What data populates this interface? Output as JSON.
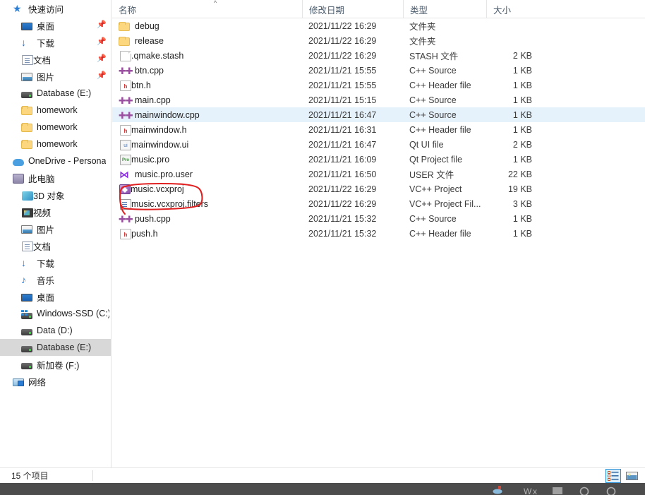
{
  "navpane": {
    "items": [
      {
        "label": "快速访问",
        "icon": "star-icon",
        "indent": 0,
        "pinned": false,
        "selected": false
      },
      {
        "label": "桌面",
        "icon": "desktop-icon",
        "indent": 1,
        "pinned": true,
        "selected": false
      },
      {
        "label": "下载",
        "icon": "downloads-icon",
        "indent": 1,
        "pinned": true,
        "selected": false
      },
      {
        "label": "文档",
        "icon": "documents-icon",
        "indent": 1,
        "pinned": true,
        "selected": false
      },
      {
        "label": "图片",
        "icon": "pictures-icon",
        "indent": 1,
        "pinned": true,
        "selected": false
      },
      {
        "label": "Database (E:)",
        "icon": "drive-icon",
        "indent": 1,
        "pinned": false,
        "selected": false
      },
      {
        "label": "homework",
        "icon": "folder-icon",
        "indent": 1,
        "pinned": false,
        "selected": false
      },
      {
        "label": "homework",
        "icon": "folder-icon",
        "indent": 1,
        "pinned": false,
        "selected": false
      },
      {
        "label": "homework",
        "icon": "folder-icon",
        "indent": 1,
        "pinned": false,
        "selected": false
      },
      {
        "label": "OneDrive - Persona",
        "icon": "onedrive-icon",
        "indent": 0,
        "pinned": false,
        "selected": false
      },
      {
        "label": "此电脑",
        "icon": "this-pc-icon",
        "indent": 0,
        "pinned": false,
        "selected": false
      },
      {
        "label": "3D 对象",
        "icon": "3d-objects-icon",
        "indent": 1,
        "pinned": false,
        "selected": false
      },
      {
        "label": "视频",
        "icon": "videos-icon",
        "indent": 1,
        "pinned": false,
        "selected": false
      },
      {
        "label": "图片",
        "icon": "pictures-icon",
        "indent": 1,
        "pinned": false,
        "selected": false
      },
      {
        "label": "文档",
        "icon": "documents-icon",
        "indent": 1,
        "pinned": false,
        "selected": false
      },
      {
        "label": "下载",
        "icon": "downloads-icon",
        "indent": 1,
        "pinned": false,
        "selected": false
      },
      {
        "label": "音乐",
        "icon": "music-icon",
        "indent": 1,
        "pinned": false,
        "selected": false
      },
      {
        "label": "桌面",
        "icon": "desktop-icon",
        "indent": 1,
        "pinned": false,
        "selected": false
      },
      {
        "label": "Windows-SSD (C:)",
        "icon": "windows-drive-icon",
        "indent": 1,
        "pinned": false,
        "selected": false
      },
      {
        "label": "Data (D:)",
        "icon": "drive-icon",
        "indent": 1,
        "pinned": false,
        "selected": false
      },
      {
        "label": "Database (E:)",
        "icon": "drive-icon",
        "indent": 1,
        "pinned": false,
        "selected": true
      },
      {
        "label": "新加卷 (F:)",
        "icon": "drive-icon",
        "indent": 1,
        "pinned": false,
        "selected": false
      },
      {
        "label": "网络",
        "icon": "network-icon",
        "indent": 0,
        "pinned": false,
        "selected": false
      }
    ]
  },
  "columns": {
    "name": "名称",
    "date_modified": "修改日期",
    "type": "类型",
    "size": "大小",
    "sort_indicator": "^",
    "sorted_by": "名称",
    "sort_direction": "ascending"
  },
  "files": [
    {
      "name": "debug",
      "date": "2021/11/22 16:29",
      "type": "文件夹",
      "size": "",
      "icon": "folder-icon",
      "selected": false
    },
    {
      "name": "release",
      "date": "2021/11/22 16:29",
      "type": "文件夹",
      "size": "",
      "icon": "folder-icon",
      "selected": false
    },
    {
      "name": ".qmake.stash",
      "date": "2021/11/22 16:29",
      "type": "STASH 文件",
      "size": "2 KB",
      "icon": "blank-file-icon",
      "selected": false
    },
    {
      "name": "btn.cpp",
      "date": "2021/11/21 15:55",
      "type": "C++ Source",
      "size": "1 KB",
      "icon": "cpp-source-icon",
      "selected": false
    },
    {
      "name": "btn.h",
      "date": "2021/11/21 15:55",
      "type": "C++ Header file",
      "size": "1 KB",
      "icon": "cpp-header-icon",
      "selected": false
    },
    {
      "name": "main.cpp",
      "date": "2021/11/21 15:15",
      "type": "C++ Source",
      "size": "1 KB",
      "icon": "cpp-source-icon",
      "selected": false
    },
    {
      "name": "mainwindow.cpp",
      "date": "2021/11/21 16:47",
      "type": "C++ Source",
      "size": "1 KB",
      "icon": "cpp-source-icon",
      "selected": true
    },
    {
      "name": "mainwindow.h",
      "date": "2021/11/21 16:31",
      "type": "C++ Header file",
      "size": "1 KB",
      "icon": "cpp-header-icon",
      "selected": false
    },
    {
      "name": "mainwindow.ui",
      "date": "2021/11/21 16:47",
      "type": "Qt UI file",
      "size": "2 KB",
      "icon": "qt-ui-icon",
      "selected": false
    },
    {
      "name": "music.pro",
      "date": "2021/11/21 16:09",
      "type": "Qt Project file",
      "size": "1 KB",
      "icon": "qt-project-icon",
      "selected": false
    },
    {
      "name": "music.pro.user",
      "date": "2021/11/21 16:50",
      "type": "USER 文件",
      "size": "22 KB",
      "icon": "visual-studio-icon",
      "selected": false
    },
    {
      "name": "music.vcxproj",
      "date": "2021/11/22 16:29",
      "type": "VC++ Project",
      "size": "19 KB",
      "icon": "vcxproj-icon",
      "selected": false
    },
    {
      "name": "music.vcxproj.filters",
      "date": "2021/11/22 16:29",
      "type": "VC++ Project Fil...",
      "size": "3 KB",
      "icon": "vcxproj-filters-icon",
      "selected": false
    },
    {
      "name": "push.cpp",
      "date": "2021/11/21 15:32",
      "type": "C++ Source",
      "size": "1 KB",
      "icon": "cpp-source-icon",
      "selected": false
    },
    {
      "name": "push.h",
      "date": "2021/11/21 15:32",
      "type": "C++ Header file",
      "size": "1 KB",
      "icon": "cpp-header-icon",
      "selected": false
    }
  ],
  "annotation": {
    "shape": "hand-drawn-red-circle",
    "targets": "music.vcxproj",
    "color": "#e02020"
  },
  "statusbar": {
    "item_count": "15 个项目",
    "details_view_label": "详细信息",
    "large_icons_view_label": "大图标"
  },
  "colors": {
    "selection": "#e5f1fb",
    "nav_selection": "#d8d8d8",
    "header_text": "#4a5a6a",
    "annotation_red": "#e02020",
    "taskbar": "#4c4c4c"
  }
}
